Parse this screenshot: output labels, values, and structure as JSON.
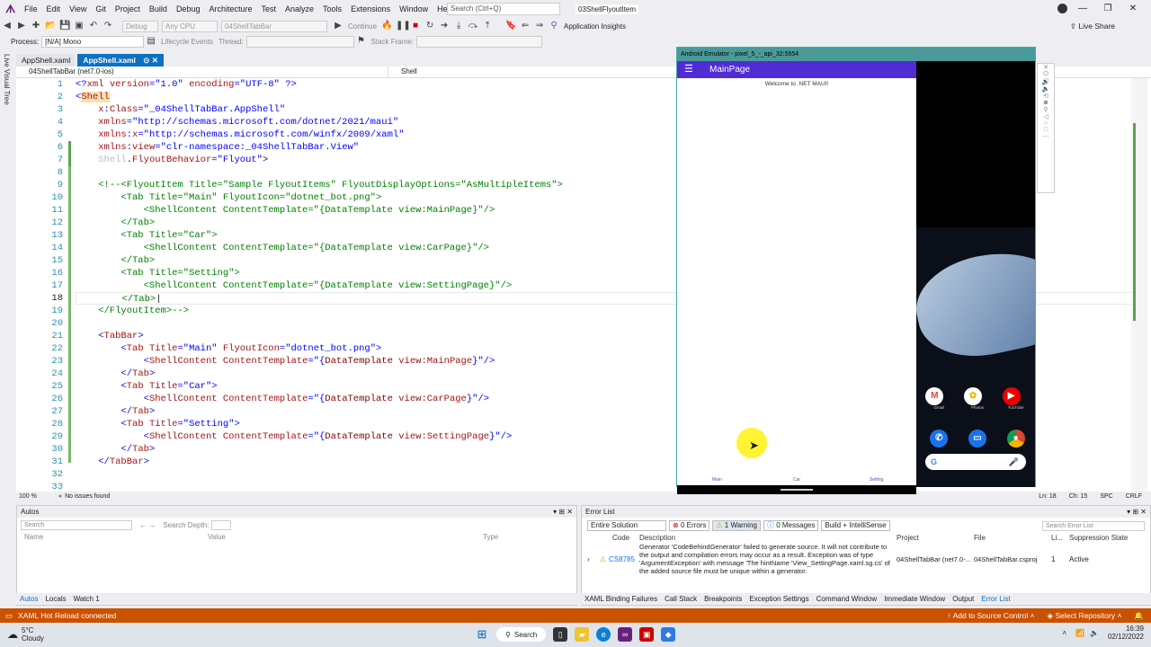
{
  "menu": {
    "items": [
      "File",
      "Edit",
      "View",
      "Git",
      "Project",
      "Build",
      "Debug",
      "Architecture",
      "Test",
      "Analyze",
      "Tools",
      "Extensions",
      "Window",
      "Help"
    ],
    "search_placeholder": "Search (Ctrl+Q)",
    "solution_name": "03ShellFlyoutItem"
  },
  "toolbar": {
    "config": "Debug",
    "platform": "Any CPU",
    "startup": "04ShellTabBar",
    "continue_label": "Continue",
    "app_insights": "Application Insights",
    "live_share": "Live Share",
    "process_label": "Process:",
    "process_value": "[N/A] Mono",
    "lifecycle": "Lifecycle Events",
    "thread_label": "Thread:",
    "stack_label": "Stack Frame:"
  },
  "leftstrip": {
    "label": "Live Visual Tree"
  },
  "tabs": [
    {
      "label": "AppShell.xaml"
    },
    {
      "label": "AppShell.xaml"
    }
  ],
  "navbar": {
    "project": "04ShellTabBar (net7.0-ios)",
    "member": "Shell"
  },
  "editor": {
    "lines": [
      {
        "n": "1",
        "html": "<span class='b'>&lt;?</span><span class='k'>xml</span> <span class='k'>version</span><span class='b'>=\"1.0\"</span> <span class='k'>encoding</span><span class='b'>=\"UTF-8\"</span> <span class='b'>?&gt;</span>"
      },
      {
        "n": "2",
        "html": "<span class='b'>&lt;</span><span class='k' style='background:#ffe0b0'>Shell</span>"
      },
      {
        "n": "3",
        "html": "    <span class='k'>x</span><span class='b'>:</span><span class='k'>Class</span><span class='b'>=\"_04ShellTabBar.AppShell\"</span>"
      },
      {
        "n": "4",
        "html": "    <span class='k'>xmlns</span><span class='b'>=\"http://schemas.microsoft.com/dotnet/2021/maui\"</span>"
      },
      {
        "n": "5",
        "html": "    <span class='k'>xmlns</span><span class='b'>:</span><span class='k'>x</span><span class='b'>=\"http://schemas.microsoft.com/winfx/2009/xaml\"</span>"
      },
      {
        "n": "6",
        "html": "    <span class='k'>xmlns</span><span class='b'>:</span><span class='k'>view</span><span class='b'>=\"clr-namespace:_04ShellTabBar.View\"</span>"
      },
      {
        "n": "7",
        "html": "    <span class='dim'>Shell</span>.<span class='k'>FlyoutBehavior</span><span class='b'>=\"Flyout\"&gt;</span>"
      },
      {
        "n": "8",
        "html": ""
      },
      {
        "n": "9",
        "html": "    <span class='g'>&lt;!--&lt;FlyoutItem Title=\"Sample FlyoutItems\" FlyoutDisplayOptions=\"AsMultipleItems\"&gt;</span>"
      },
      {
        "n": "10",
        "html": "<span class='g'>        &lt;Tab Title=\"Main\" FlyoutIcon=\"dotnet_bot.png\"&gt;</span>"
      },
      {
        "n": "11",
        "html": "<span class='g'>            &lt;ShellContent ContentTemplate=\"{DataTemplate view:MainPage}\"/&gt;</span>"
      },
      {
        "n": "12",
        "html": "<span class='g'>        &lt;/Tab&gt;</span>"
      },
      {
        "n": "13",
        "html": "<span class='g'>        &lt;Tab Title=\"Car\"&gt;</span>"
      },
      {
        "n": "14",
        "html": "<span class='g'>            &lt;ShellContent ContentTemplate=\"{DataTemplate view:CarPage}\"/&gt;</span>"
      },
      {
        "n": "15",
        "html": "<span class='g'>        &lt;/Tab&gt;</span>"
      },
      {
        "n": "16",
        "html": "<span class='g'>        &lt;Tab Title=\"Setting\"&gt;</span>"
      },
      {
        "n": "17",
        "html": "<span class='g'>            &lt;ShellContent ContentTemplate=\"{DataTemplate view:SettingPage}\"/&gt;</span>"
      },
      {
        "n": "18",
        "html": "<span class='g'>        &lt;/Tab&gt;</span>|"
      },
      {
        "n": "19",
        "html": "<span class='g'>    &lt;/FlyoutItem&gt;--&gt;</span>"
      },
      {
        "n": "20",
        "html": ""
      },
      {
        "n": "21",
        "html": "    <span class='b'>&lt;</span><span class='k'>TabBar</span><span class='b'>&gt;</span>"
      },
      {
        "n": "22",
        "html": "        <span class='b'>&lt;</span><span class='k'>Tab</span> <span class='k'>Title</span><span class='b'>=\"Main\"</span> <span class='k'>FlyoutIcon</span><span class='b'>=\"dotnet_bot.png\"&gt;</span>"
      },
      {
        "n": "23",
        "html": "            <span class='b'>&lt;</span><span class='k'>ShellContent</span> <span class='k'>ContentTemplate</span><span class='b'>=\"{</span><span class='m'>DataTemplate</span> <span class='k'>view:MainPage</span><span class='b'>}\"/&gt;</span>"
      },
      {
        "n": "24",
        "html": "        <span class='b'>&lt;/</span><span class='k'>Tab</span><span class='b'>&gt;</span>"
      },
      {
        "n": "25",
        "html": "        <span class='b'>&lt;</span><span class='k'>Tab</span> <span class='k'>Title</span><span class='b'>=\"Car\"&gt;</span>"
      },
      {
        "n": "26",
        "html": "            <span class='b'>&lt;</span><span class='k'>ShellContent</span> <span class='k'>ContentTemplate</span><span class='b'>=\"{</span><span class='m'>DataTemplate</span> <span class='k'>view:CarPage</span><span class='b'>}\"/&gt;</span>"
      },
      {
        "n": "27",
        "html": "        <span class='b'>&lt;/</span><span class='k'>Tab</span><span class='b'>&gt;</span>"
      },
      {
        "n": "28",
        "html": "        <span class='b'>&lt;</span><span class='k'>Tab</span> <span class='k'>Title</span><span class='b'>=\"Setting\"&gt;</span>"
      },
      {
        "n": "29",
        "html": "            <span class='b'>&lt;</span><span class='k'>ShellContent</span> <span class='k'>ContentTemplate</span><span class='b'>=\"{</span><span class='m'>DataTemplate</span> <span class='k'>view:SettingPage</span><span class='b'>}\"/&gt;</span>"
      },
      {
        "n": "30",
        "html": "        <span class='b'>&lt;/</span><span class='k'>Tab</span><span class='b'>&gt;</span>"
      },
      {
        "n": "31",
        "html": "    <span class='b'>&lt;/</span><span class='k'>TabBar</span><span class='b'>&gt;</span>"
      },
      {
        "n": "32",
        "html": ""
      },
      {
        "n": "33",
        "html": ""
      }
    ],
    "zoom": "100 %",
    "issues": "No issues found",
    "ln": "Ln: 18",
    "ch": "Ch: 15",
    "spc": "SPC",
    "crlf": "CRLF"
  },
  "emulator": {
    "title": "Android Emulator - pixel_5_-_api_32:5554",
    "appbar_title": "MainPage",
    "welcome": "Welcome to .NET MAUI!",
    "tabs": [
      "Main",
      "Car",
      "Setting"
    ],
    "apps": [
      "Gmail",
      "Photos",
      "YouTube"
    ]
  },
  "autos": {
    "title": "Autos",
    "search": "Search",
    "depth": "Search Depth:",
    "cols": [
      "Name",
      "Value",
      "Type"
    ]
  },
  "errorlist": {
    "title": "Error List",
    "scope": "Entire Solution",
    "errors": "0 Errors",
    "warnings": "1 Warning",
    "messages": "0 Messages",
    "build": "Build + IntelliSense",
    "search": "Search Error List",
    "cols": [
      "Code",
      "Description",
      "Project",
      "File",
      "Li...",
      "Suppression State"
    ],
    "row": {
      "code": "CS8785",
      "desc": "Generator 'CodeBehindGenerator' failed to generate source. It will not contribute to the output and compilation errors may occur as a result. Exception was of type 'ArgumentException' with message 'The hintName 'View_SettingPage.xaml.sg.cs' of the added source file must be unique within a generator.",
      "project": "04ShellTabBar (net7.0-...",
      "file": "04ShellTabBar.csproj",
      "line": "1",
      "state": "Active"
    }
  },
  "bottomtabs_left": [
    "Autos",
    "Locals",
    "Watch 1"
  ],
  "bottomtabs_right": [
    "XAML Binding Failures",
    "Call Stack",
    "Breakpoints",
    "Exception Settings",
    "Command Window",
    "Immediate Window",
    "Output",
    "Error List"
  ],
  "statusbar": {
    "left": "XAML Hot Reload connected",
    "source": "Add to Source Control",
    "repo": "Select Repository"
  },
  "taskbar": {
    "temp": "5°C",
    "weather": "Cloudy",
    "search": "Search",
    "time": "16:39",
    "date": "02/12/2022"
  }
}
